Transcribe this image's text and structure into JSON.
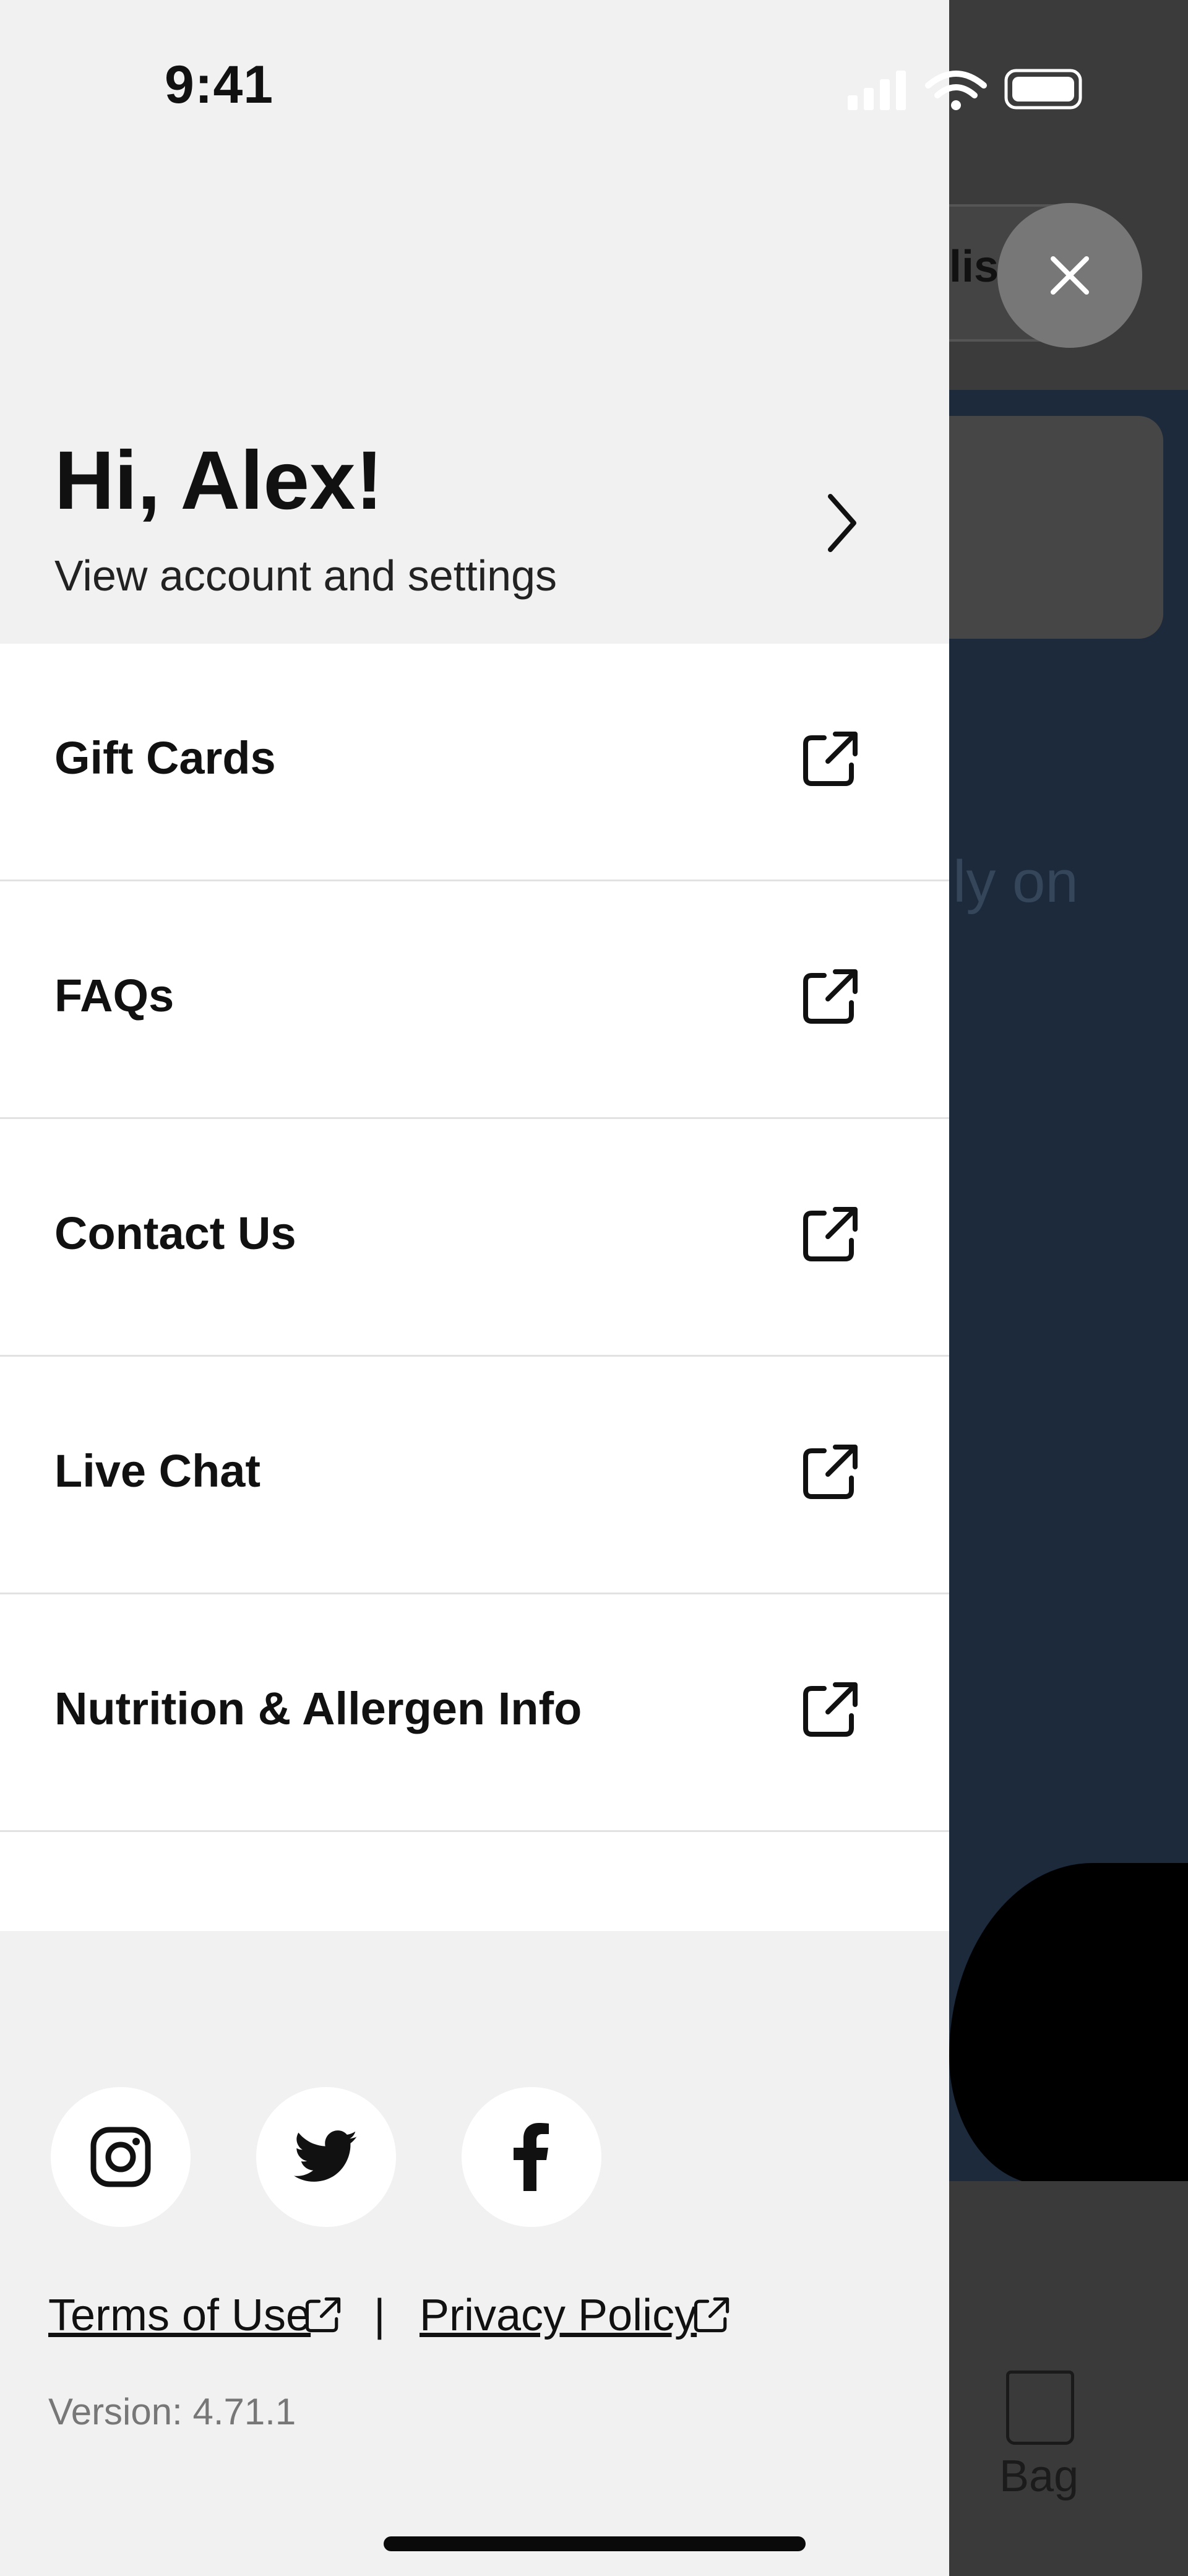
{
  "status_bar": {
    "time": "9:41"
  },
  "background": {
    "pill_text": "lis",
    "body_text": "ly on",
    "tab_bag_label": "Bag"
  },
  "drawer": {
    "greeting": "Hi, Alex!",
    "subtitle": "View account and settings",
    "menu_items": [
      {
        "label": "Gift Cards",
        "icon": "external-link-icon"
      },
      {
        "label": "FAQs",
        "icon": "external-link-icon"
      },
      {
        "label": "Contact Us",
        "icon": "external-link-icon"
      },
      {
        "label": "Live Chat",
        "icon": "external-link-icon"
      },
      {
        "label": "Nutrition & Allergen Info",
        "icon": "external-link-icon"
      }
    ],
    "social": [
      "instagram-icon",
      "twitter-icon",
      "facebook-icon"
    ],
    "terms_label": "Terms of Use",
    "separator": "|",
    "privacy_label": "Privacy Policy",
    "version": "Version: 4.71.1"
  },
  "colors": {
    "drawer_bg": "#f1f1f1",
    "overlay_bg": "#1c2a3c",
    "close_bg": "#777777"
  }
}
